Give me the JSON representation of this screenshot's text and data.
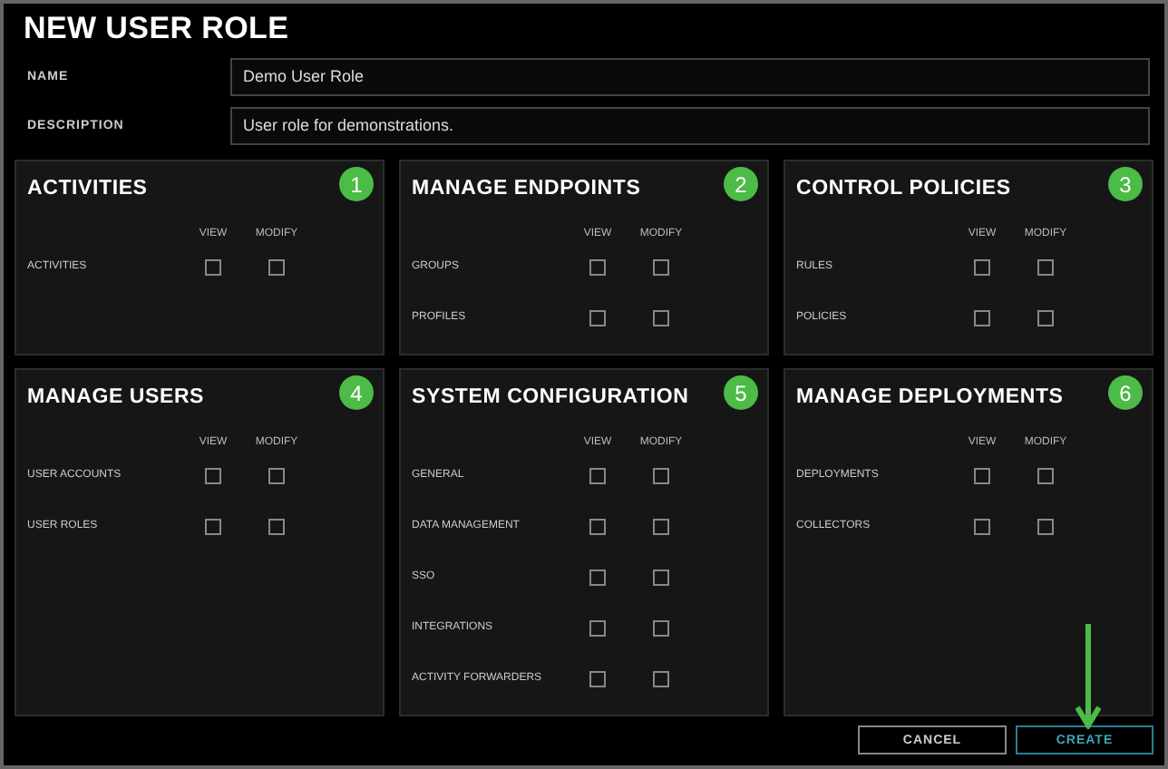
{
  "window": {
    "title": "NEW USER ROLE"
  },
  "fields": [
    {
      "label": "NAME",
      "value": "Demo User Role"
    },
    {
      "label": "DESCRIPTION",
      "value": "User role for demonstrations."
    }
  ],
  "panels": [
    {
      "title": "ACTIVITIES",
      "badge": "1",
      "columns": [
        "VIEW",
        "MODIFY"
      ],
      "rows": [
        {
          "label": "ACTIVITIES",
          "view": false,
          "modify": false
        }
      ]
    },
    {
      "title": "MANAGE ENDPOINTS",
      "badge": "2",
      "columns": [
        "VIEW",
        "MODIFY"
      ],
      "rows": [
        {
          "label": "GROUPS",
          "view": false,
          "modify": false
        },
        {
          "label": "PROFILES",
          "view": false,
          "modify": false
        }
      ]
    },
    {
      "title": "CONTROL POLICIES",
      "badge": "3",
      "columns": [
        "VIEW",
        "MODIFY"
      ],
      "rows": [
        {
          "label": "RULES",
          "view": false,
          "modify": false
        },
        {
          "label": "POLICIES",
          "view": false,
          "modify": false
        }
      ]
    },
    {
      "title": "MANAGE USERS",
      "badge": "4",
      "columns": [
        "VIEW",
        "MODIFY"
      ],
      "rows": [
        {
          "label": "USER ACCOUNTS",
          "view": false,
          "modify": false
        },
        {
          "label": "USER ROLES",
          "view": false,
          "modify": false
        }
      ]
    },
    {
      "title": "SYSTEM CONFIGURATION",
      "badge": "5",
      "columns": [
        "VIEW",
        "MODIFY"
      ],
      "rows": [
        {
          "label": "GENERAL",
          "view": false,
          "modify": false
        },
        {
          "label": "DATA MANAGEMENT",
          "view": false,
          "modify": false
        },
        {
          "label": "SSO",
          "view": false,
          "modify": false
        },
        {
          "label": "INTEGRATIONS",
          "view": false,
          "modify": false
        },
        {
          "label": "ACTIVITY FORWARDERS",
          "view": false,
          "modify": false
        }
      ]
    },
    {
      "title": "MANAGE DEPLOYMENTS",
      "badge": "6",
      "columns": [
        "VIEW",
        "MODIFY"
      ],
      "rows": [
        {
          "label": "DEPLOYMENTS",
          "view": false,
          "modify": false
        },
        {
          "label": "COLLECTORS",
          "view": false,
          "modify": false
        }
      ]
    }
  ],
  "buttons": [
    {
      "label": "CANCEL",
      "kind": "secondary"
    },
    {
      "label": "CREATE",
      "kind": "primary"
    }
  ]
}
